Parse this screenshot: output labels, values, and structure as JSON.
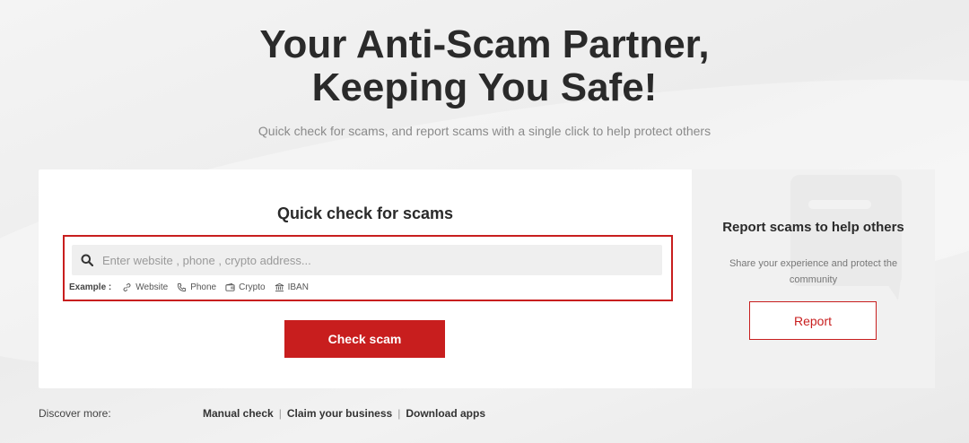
{
  "hero": {
    "title_line1": "Your Anti-Scam Partner,",
    "title_line2": "Keeping You Safe!",
    "subtitle": "Quick check for scams, and report scams with a single click to help protect others"
  },
  "quick_check": {
    "title": "Quick check for scams",
    "search": {
      "placeholder": "Enter website , phone , crypto address...",
      "value": "",
      "icon": "search-icon"
    },
    "examples": {
      "label": "Example :",
      "items": [
        {
          "label": "Website",
          "icon": "link-icon"
        },
        {
          "label": "Phone",
          "icon": "phone-icon"
        },
        {
          "label": "Crypto",
          "icon": "wallet-icon"
        },
        {
          "label": "IBAN",
          "icon": "bank-icon"
        }
      ]
    },
    "button_label": "Check scam"
  },
  "report": {
    "title": "Report scams to help others",
    "text": "Share your experience and protect the community",
    "button_label": "Report"
  },
  "footer": {
    "discover_label": "Discover more:",
    "links": [
      "Manual check",
      "Claim your business",
      "Download apps"
    ]
  },
  "colors": {
    "accent": "#c81e1e",
    "text": "#2a2a2a",
    "muted": "#8a8a8a"
  }
}
